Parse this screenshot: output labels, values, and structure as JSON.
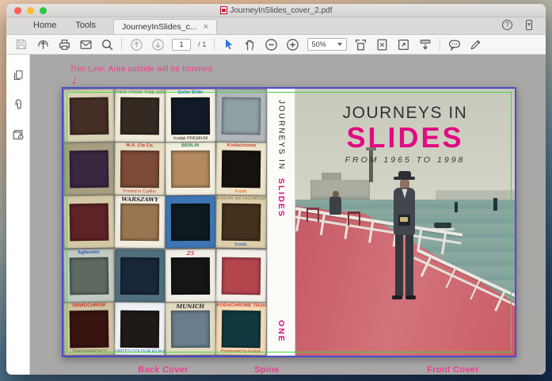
{
  "window": {
    "title": "JourneyInSlides_cover_2.pdf"
  },
  "tabs": {
    "home": "Home",
    "tools": "Tools",
    "document": "JourneyInSlides_c...",
    "close": "×"
  },
  "toolbar": {
    "page_current": "1",
    "page_total": "/ 1",
    "zoom_level": "50%",
    "help_glyph": "?"
  },
  "annotation": {
    "text": "Trim Line: Area outside will be trimmed.",
    "arrow": "↓"
  },
  "canvas_labels": {
    "back_cover": "Back Cover",
    "spine": "Spine",
    "front_cover": "Front Cover"
  },
  "cover": {
    "front": {
      "title_line1": "JOURNEYS IN",
      "title_line2": "SLIDES",
      "subtitle": "FROM 1965 TO 1998"
    },
    "spine": {
      "title_line1": "JOURNEYS IN",
      "title_line2": "SLIDES",
      "volume": "ONE"
    }
  },
  "colors": {
    "accent_pink": "#ee3a90",
    "title_pink": "#e10b82",
    "trim_blue": "#4d4ccc",
    "trim_green": "#49d649",
    "traffic_red": "#ff5f57",
    "traffic_yellow": "#febc2e",
    "traffic_green": "#28c840"
  },
  "slides": [
    {
      "frame": "#d8d1b4",
      "photo": "#452e26",
      "top": "",
      "bottom": "",
      "tc": "#2e9a96",
      "bc": "#2e9a96"
    },
    {
      "frame": "#efead9",
      "photo": "#342a22",
      "top": "VIEW FROM THIS SIDE",
      "bottom": "",
      "tc": "#8a8274",
      "bc": "#333333"
    },
    {
      "frame": "#f5f1e4",
      "photo": "#121a28",
      "top": "Color Slide",
      "bottom": "Kodak PREMIUM",
      "tc": "#1b6ad4",
      "bc": "#1f1f1f"
    },
    {
      "frame": "#b2b7bb",
      "photo": "#8da0a4",
      "top": "",
      "bottom": "",
      "tc": "#333333",
      "bc": "#333333"
    },
    {
      "frame": "#a59e80",
      "photo": "#3a2741",
      "top": "",
      "bottom": "",
      "tc": "#2e9a96",
      "bc": "#2e9a96"
    },
    {
      "frame": "#e8dec6",
      "photo": "#7c4a37",
      "top": "M.A. Cia Co.",
      "bottom": "Printed in Cuéllar",
      "tc": "#c33b2e",
      "bc": "#c33b2e"
    },
    {
      "frame": "#f3efe1",
      "photo": "#b28a5e",
      "top": "BERLIN",
      "bottom": "",
      "tc": "#3a8a46",
      "bc": "#333333"
    },
    {
      "frame": "#eee4ca",
      "photo": "#16130f",
      "top": "Kodachrome",
      "bottom": "Kodak",
      "tc": "#cf4237",
      "bc": "#e06212"
    },
    {
      "frame": "#d4c9a6",
      "photo": "#5d2327",
      "top": "",
      "bottom": "",
      "tc": "#2f6fb2",
      "bc": "#333333"
    },
    {
      "frame": "#f1ede0",
      "photo": "#997650",
      "top": "WARSZAWY",
      "bottom": "",
      "tc": "#2a2a2a",
      "bc": "#333333"
    },
    {
      "frame": "#3e76b4",
      "photo": "#0d1a20",
      "top": "",
      "bottom": "",
      "tc": "#ffffff",
      "bc": "#ffffff"
    },
    {
      "frame": "#ddcfab",
      "photo": "#45301d",
      "top": "KODAK EKTACHROME",
      "bottom": "Kodak",
      "tc": "#9a8a62",
      "bc": "#1a50b0"
    },
    {
      "frame": "#c2cac1",
      "photo": "#5d6961",
      "top": "Agfacolor",
      "bottom": "",
      "tc": "#2a52b8",
      "bc": "#333333"
    },
    {
      "frame": "#4f6f7d",
      "photo": "#172739",
      "top": "",
      "bottom": "",
      "tc": "#ffffff",
      "bc": "#ffffff"
    },
    {
      "frame": "#f1eee5",
      "photo": "#151515",
      "top": "25",
      "bottom": "",
      "tc": "#d23232",
      "bc": "#333333"
    },
    {
      "frame": "#f3efe9",
      "photo": "#b4454d",
      "top": "",
      "bottom": "",
      "tc": "#333333",
      "bc": "#333333"
    },
    {
      "frame": "#cec1a0",
      "photo": "#391410",
      "top": "ORWOCHROM",
      "bottom": "TRANSPARENCY",
      "tc": "#c2342a",
      "bc": "#6a5a3a"
    },
    {
      "frame": "#edf1f5",
      "photo": "#1f1a17",
      "top": "",
      "bottom": "UNITED COLOUR FILM EST.",
      "tc": "#2a66c0",
      "bc": "#2a66c0"
    },
    {
      "frame": "#e3dbc1",
      "photo": "#697d8d",
      "top": "MUNICH",
      "bottom": "",
      "tc": "#2a2a2a",
      "bc": "#333333"
    },
    {
      "frame": "#f4d8b4",
      "photo": "#113940",
      "top": "KODACHROME TRANSPARENCY",
      "bottom": "Processed by Kodak",
      "tc": "#d0413a",
      "bc": "#cc2a1f"
    }
  ]
}
